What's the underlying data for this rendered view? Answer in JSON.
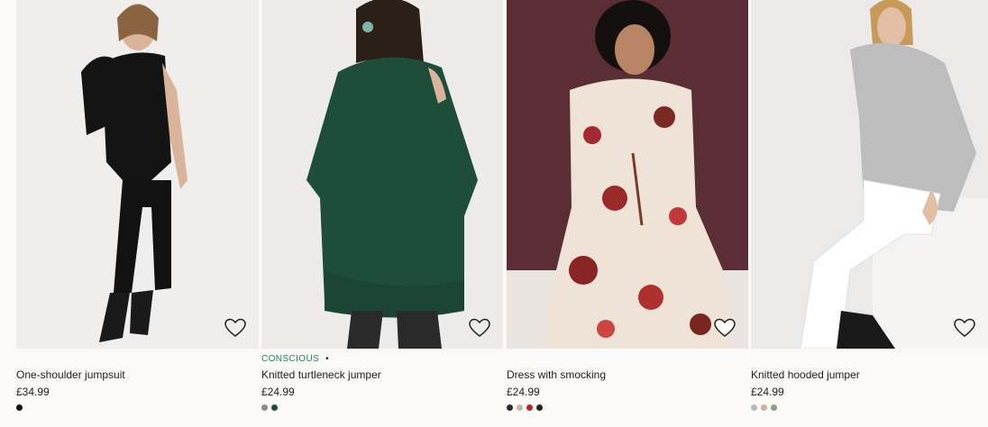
{
  "products": [
    {
      "tag": "",
      "name": "One-shoulder jumpsuit",
      "price": "£34.99",
      "swatches": [
        "#111111"
      ]
    },
    {
      "tag": "CONSCIOUS",
      "tag_sep": "•",
      "name": "Knitted turtleneck jumper",
      "price": "£24.99",
      "swatches": [
        "#8a8a8a",
        "#1e4e3a"
      ]
    },
    {
      "tag": "",
      "name": "Dress with smocking",
      "price": "£24.99",
      "swatches": [
        "#2a2a2a",
        "#c9b7a6",
        "#c0202a",
        "#222222"
      ]
    },
    {
      "tag": "",
      "name": "Knitted hooded jumper",
      "price": "£24.99",
      "swatches": [
        "#b9b9b9",
        "#c8b59a",
        "#8aa08f"
      ]
    }
  ],
  "icons": {
    "favourite": "heart-outline-icon"
  },
  "colors": {
    "tag": "#1a8a5a",
    "text": "#222222",
    "background": "#faf9f8"
  }
}
